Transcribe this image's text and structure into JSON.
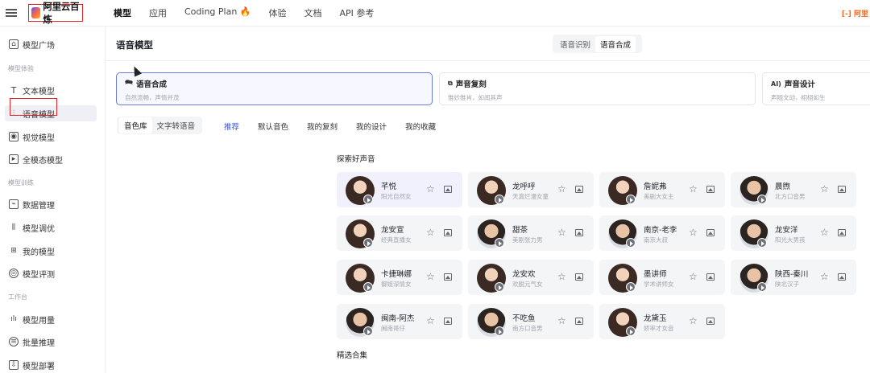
{
  "brand": {
    "name": "阿里云百炼"
  },
  "topnav": [
    {
      "label": "模型",
      "active": true
    },
    {
      "label": "应用"
    },
    {
      "label": "Coding Plan"
    },
    {
      "label": "体验"
    },
    {
      "label": "文档"
    },
    {
      "label": "API 参考"
    }
  ],
  "top_right": "[-] 阿里",
  "sidebar": {
    "sections": {
      "experience": "模型体验",
      "training": "模型训练",
      "workbench": "工作台"
    },
    "items": [
      {
        "label": "模型广场",
        "icon": "model-square-icon"
      },
      {
        "label": "文本模型",
        "icon": "text-icon"
      },
      {
        "label": "语音模型",
        "icon": "audio-wave-icon",
        "active": true
      },
      {
        "label": "视觉模型",
        "icon": "camera-icon"
      },
      {
        "label": "全模态模型",
        "icon": "multimodal-icon"
      },
      {
        "label": "数据管理",
        "icon": "data-icon"
      },
      {
        "label": "模型调优",
        "icon": "tune-icon"
      },
      {
        "label": "我的模型",
        "icon": "my-model-icon"
      },
      {
        "label": "模型评测",
        "icon": "evaluation-icon"
      },
      {
        "label": "模型用量",
        "icon": "usage-chart-icon"
      },
      {
        "label": "批量推理",
        "icon": "batch-icon"
      },
      {
        "label": "模型部署",
        "icon": "deploy-icon"
      }
    ]
  },
  "page": {
    "title": "语音模型",
    "segments": [
      {
        "label": "语音识别"
      },
      {
        "label": "语音合成",
        "on": true
      }
    ]
  },
  "features": [
    {
      "title": "语音合成",
      "desc": "自然流畅，声情并茂",
      "selected": true
    },
    {
      "title": "声音复刻",
      "desc": "惟妙惟肖，如闻其声"
    },
    {
      "title": "声音设计",
      "desc": "声随文动，栩栩如生"
    }
  ],
  "library_tabs": [
    {
      "label": "音色库",
      "on": true
    },
    {
      "label": "文字转语音"
    }
  ],
  "subtabs": [
    {
      "label": "推荐",
      "on": true
    },
    {
      "label": "默认音色"
    },
    {
      "label": "我的复刻"
    },
    {
      "label": "我的设计"
    },
    {
      "label": "我的收藏"
    }
  ],
  "explore_title": "探索好声音",
  "featured_title": "精选合集",
  "voices": [
    {
      "name": "芊悦",
      "desc": "阳光自然女",
      "gender": "f"
    },
    {
      "name": "龙呼呼",
      "desc": "天真烂漫女童",
      "gender": "f"
    },
    {
      "name": "詹妮弗",
      "desc": "美剧大女主",
      "gender": "f"
    },
    {
      "name": "晨煦",
      "desc": "北方口音男",
      "gender": "m"
    },
    {
      "name": "龙安宣",
      "desc": "经典直播女",
      "gender": "f"
    },
    {
      "name": "甜茶",
      "desc": "美剧张力男",
      "gender": "m"
    },
    {
      "name": "南京-老李",
      "desc": "南京大叔",
      "gender": "m"
    },
    {
      "name": "龙安洋",
      "desc": "阳光大男孩",
      "gender": "m"
    },
    {
      "name": "卡捷琳娜",
      "desc": "御姐深情女",
      "gender": "f"
    },
    {
      "name": "龙安欢",
      "desc": "欢脱元气女",
      "gender": "f"
    },
    {
      "name": "墨讲师",
      "desc": "学术讲师女",
      "gender": "f"
    },
    {
      "name": "陕西-秦川",
      "desc": "陕北汉子",
      "gender": "m"
    },
    {
      "name": "闽南-阿杰",
      "desc": "闽南哥仔",
      "gender": "m"
    },
    {
      "name": "不吃鱼",
      "desc": "南方口音男",
      "gender": "m"
    },
    {
      "name": "龙黛玉",
      "desc": "娇率才女音",
      "gender": "f"
    }
  ]
}
